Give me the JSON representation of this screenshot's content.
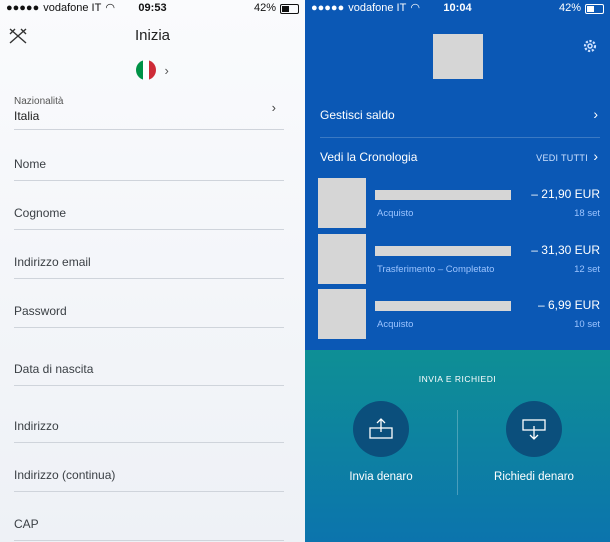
{
  "left": {
    "status": {
      "carrier": "vodafone IT",
      "time": "09:53",
      "battery": "42%"
    },
    "title": "Inizia",
    "fields": {
      "nationality_label": "Nazionalità",
      "nationality_value": "Italia",
      "nome": "Nome",
      "cognome": "Cognome",
      "email": "Indirizzo email",
      "password": "Password",
      "birth": "Data di nascita",
      "indirizzo": "Indirizzo",
      "indirizzo2": "Indirizzo (continua)",
      "cap": "CAP"
    },
    "flag_colors": [
      "#009246",
      "#ffffff",
      "#ce2b37"
    ]
  },
  "right": {
    "status": {
      "carrier": "vodafone IT",
      "time": "10:04",
      "battery": "42%"
    },
    "manage_balance": "Gestisci saldo",
    "history": "Vedi la Cronologia",
    "see_all": "VEDI TUTTI",
    "transactions": [
      {
        "type": "Acquisto",
        "amount": "– 21,90 EUR",
        "date": "18 set"
      },
      {
        "type": "Trasferimento – Completato",
        "amount": "– 31,30 EUR",
        "date": "12 set"
      },
      {
        "type": "Acquisto",
        "amount": "– 6,99 EUR",
        "date": "10 set"
      }
    ],
    "send_request_title": "INVIA E RICHIEDI",
    "send_money": "Invia denaro",
    "request_money": "Richiedi denaro"
  }
}
